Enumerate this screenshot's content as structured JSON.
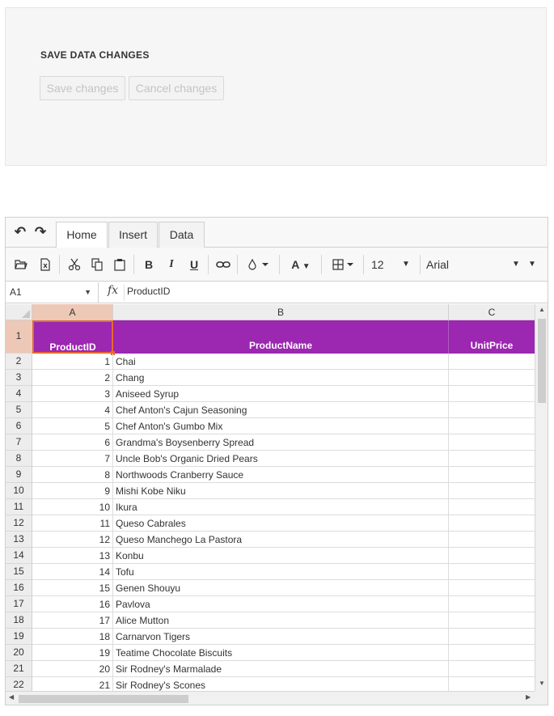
{
  "panel": {
    "title": "SAVE DATA CHANGES",
    "save_label": "Save changes",
    "cancel_label": "Cancel changes"
  },
  "spreadsheet": {
    "tabs": [
      "Home",
      "Insert",
      "Data"
    ],
    "active_tab": "Home",
    "font_size": "12",
    "font_name": "Arial",
    "name_box": "A1",
    "fx_label": "fx",
    "formula_value": "ProductID",
    "columns": [
      "A",
      "B",
      "C"
    ],
    "row_numbers": [
      "1",
      "2",
      "3",
      "4",
      "5",
      "6",
      "7",
      "8",
      "9",
      "10",
      "11",
      "12",
      "13",
      "14",
      "15",
      "16",
      "17",
      "18",
      "19",
      "20",
      "21",
      "22"
    ],
    "header_row": [
      "ProductID",
      "ProductName",
      "UnitPrice"
    ],
    "rows": [
      [
        "1",
        "Chai"
      ],
      [
        "2",
        "Chang"
      ],
      [
        "3",
        "Aniseed Syrup"
      ],
      [
        "4",
        "Chef Anton's Cajun Seasoning"
      ],
      [
        "5",
        "Chef Anton's Gumbo Mix"
      ],
      [
        "6",
        "Grandma's Boysenberry Spread"
      ],
      [
        "7",
        "Uncle Bob's Organic Dried Pears"
      ],
      [
        "8",
        "Northwoods Cranberry Sauce"
      ],
      [
        "9",
        "Mishi Kobe Niku"
      ],
      [
        "10",
        "Ikura"
      ],
      [
        "11",
        "Queso Cabrales"
      ],
      [
        "12",
        "Queso Manchego La Pastora"
      ],
      [
        "13",
        "Konbu"
      ],
      [
        "14",
        "Tofu"
      ],
      [
        "15",
        "Genen Shouyu"
      ],
      [
        "16",
        "Pavlova"
      ],
      [
        "17",
        "Alice Mutton"
      ],
      [
        "18",
        "Carnarvon Tigers"
      ],
      [
        "19",
        "Teatime Chocolate Biscuits"
      ],
      [
        "20",
        "Sir Rodney's Marmalade"
      ],
      [
        "21",
        "Sir Rodney's Scones"
      ]
    ],
    "colors": {
      "header_fill": "#9c27b0",
      "header_text": "#ffffff",
      "selection_border": "#e8682c",
      "selected_header": "#edc8b7"
    }
  }
}
